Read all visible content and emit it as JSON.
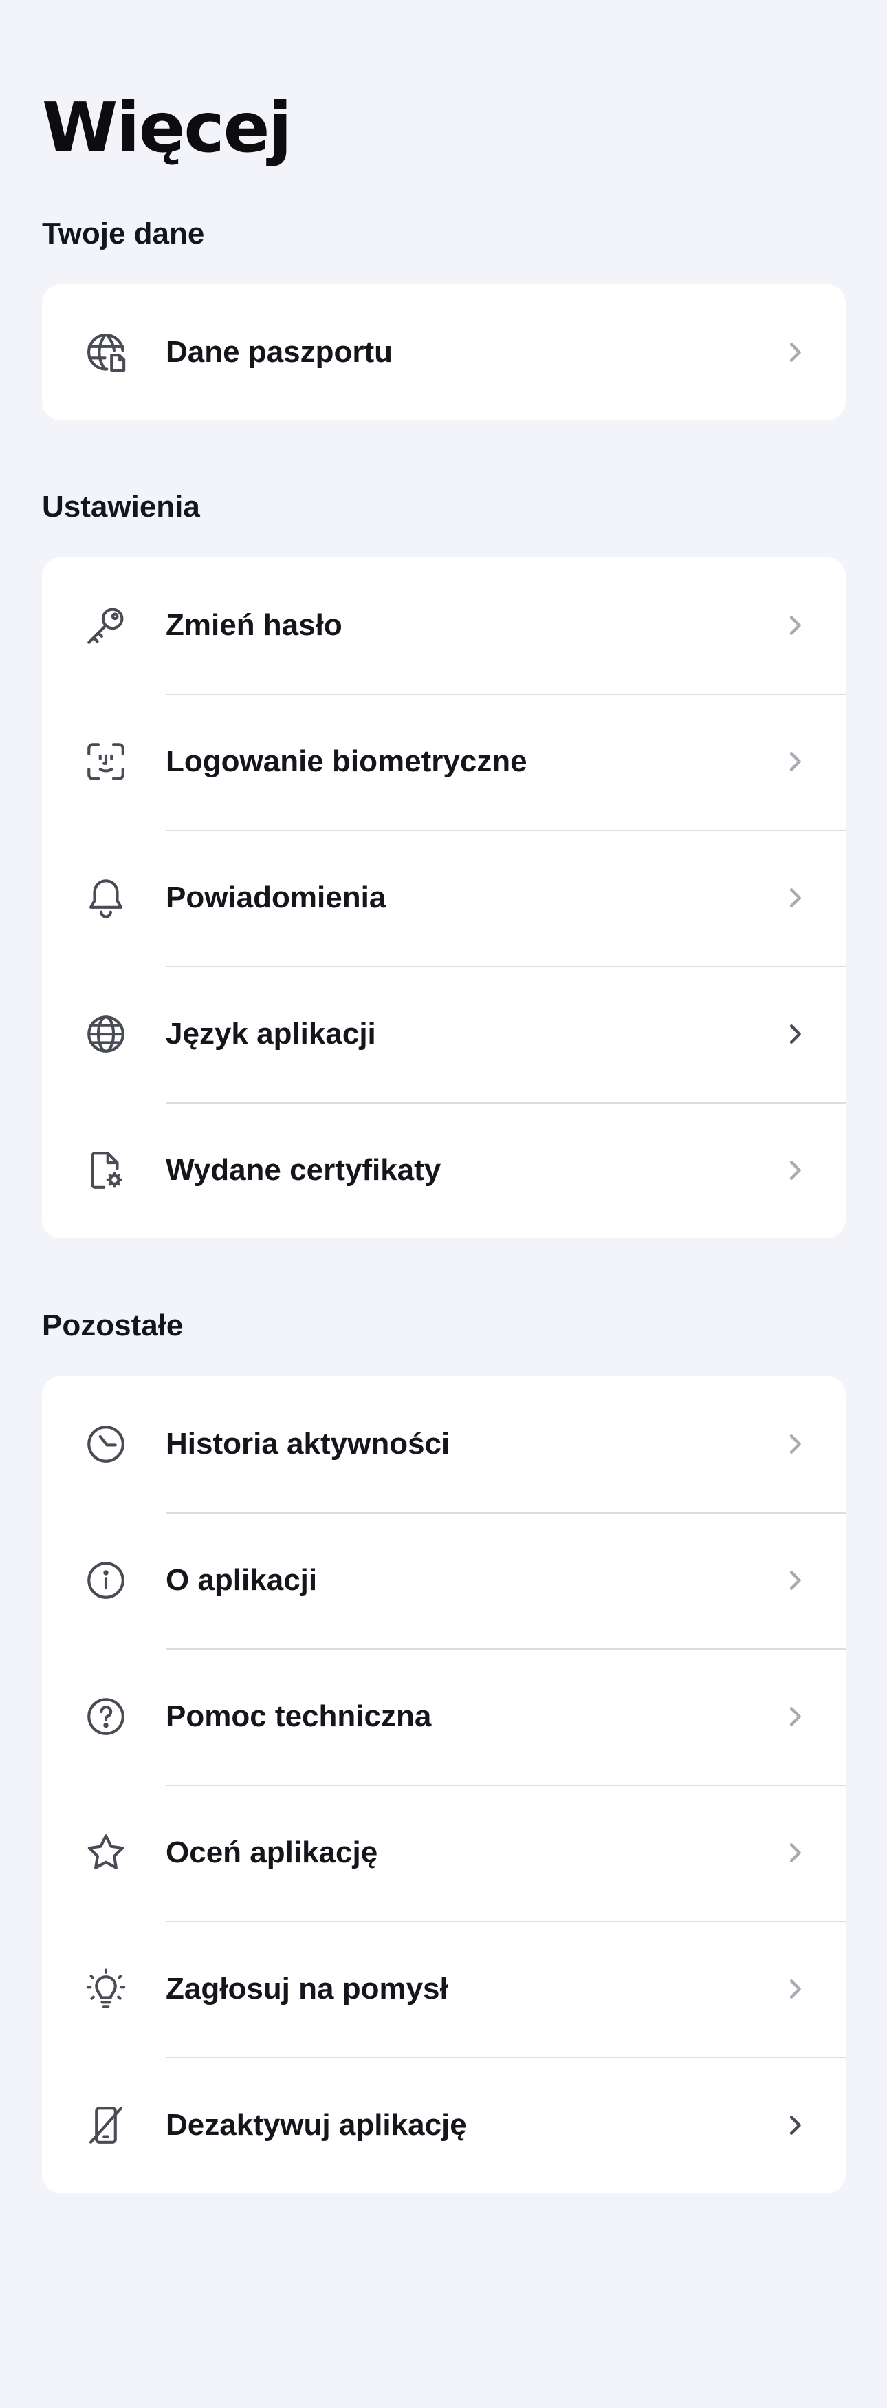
{
  "header": {
    "title": "Więcej"
  },
  "sections": [
    {
      "heading": "Twoje dane",
      "items": [
        {
          "label": "Dane paszportu",
          "icon": "globe-document-icon",
          "chevron": "light"
        }
      ]
    },
    {
      "heading": "Ustawienia",
      "items": [
        {
          "label": "Zmień hasło",
          "icon": "key-icon",
          "chevron": "light"
        },
        {
          "label": "Logowanie biometryczne",
          "icon": "face-id-icon",
          "chevron": "light"
        },
        {
          "label": "Powiadomienia",
          "icon": "bell-icon",
          "chevron": "light"
        },
        {
          "label": "Język aplikacji",
          "icon": "globe-icon",
          "chevron": "dark"
        },
        {
          "label": "Wydane certyfikaty",
          "icon": "certificate-document-icon",
          "chevron": "light"
        }
      ]
    },
    {
      "heading": "Pozostałe",
      "items": [
        {
          "label": "Historia aktywności",
          "icon": "clock-icon",
          "chevron": "light"
        },
        {
          "label": "O aplikacji",
          "icon": "info-icon",
          "chevron": "light"
        },
        {
          "label": "Pomoc techniczna",
          "icon": "help-icon",
          "chevron": "light"
        },
        {
          "label": "Oceń aplikację",
          "icon": "star-icon",
          "chevron": "light"
        },
        {
          "label": "Zagłosuj na pomysł",
          "icon": "lightbulb-icon",
          "chevron": "light"
        },
        {
          "label": "Dezaktywuj aplikację",
          "icon": "phone-off-icon",
          "chevron": "dark"
        }
      ]
    }
  ],
  "colors": {
    "background": "#f3f4fa",
    "card": "#ffffff",
    "text": "#15161c",
    "icon": "#4a4c55",
    "divider": "#dcdde3",
    "chevron_light": "#a9abb3",
    "chevron_dark": "#4a4c55"
  }
}
